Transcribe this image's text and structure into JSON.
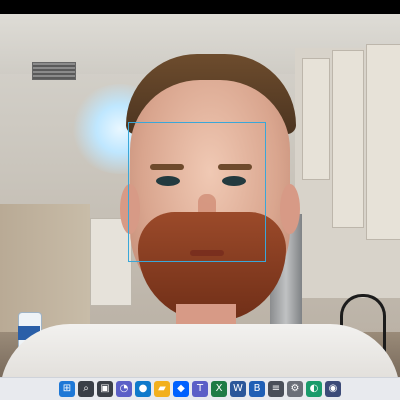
{
  "taskbar": {
    "icons": [
      {
        "name": "start-icon",
        "glyph": "⊞",
        "bg": "#1e78d6"
      },
      {
        "name": "search-icon",
        "glyph": "⌕",
        "bg": "#3a3f47"
      },
      {
        "name": "task-view-icon",
        "glyph": "▣",
        "bg": "#3a3f47"
      },
      {
        "name": "chat-icon",
        "glyph": "◔",
        "bg": "#5b5fc7"
      },
      {
        "name": "edge-icon",
        "glyph": "●",
        "bg": "#0f7acb"
      },
      {
        "name": "file-explorer-icon",
        "glyph": "▰",
        "bg": "#f2b01e"
      },
      {
        "name": "dropbox-icon",
        "glyph": "◆",
        "bg": "#0061ff"
      },
      {
        "name": "teams-icon",
        "glyph": "T",
        "bg": "#5b5fc7"
      },
      {
        "name": "excel-icon",
        "glyph": "X",
        "bg": "#1f7b45"
      },
      {
        "name": "word-icon",
        "glyph": "W",
        "bg": "#2b579a"
      },
      {
        "name": "bold-app-icon",
        "glyph": "B",
        "bg": "#1f5fb5"
      },
      {
        "name": "stack-icon",
        "glyph": "≡",
        "bg": "#4a4f59"
      },
      {
        "name": "settings-icon",
        "glyph": "⚙",
        "bg": "#6b6f78"
      },
      {
        "name": "media-icon",
        "glyph": "◐",
        "bg": "#1a9b6b"
      },
      {
        "name": "camera-icon",
        "glyph": "◉",
        "bg": "#3c4b78"
      }
    ]
  }
}
